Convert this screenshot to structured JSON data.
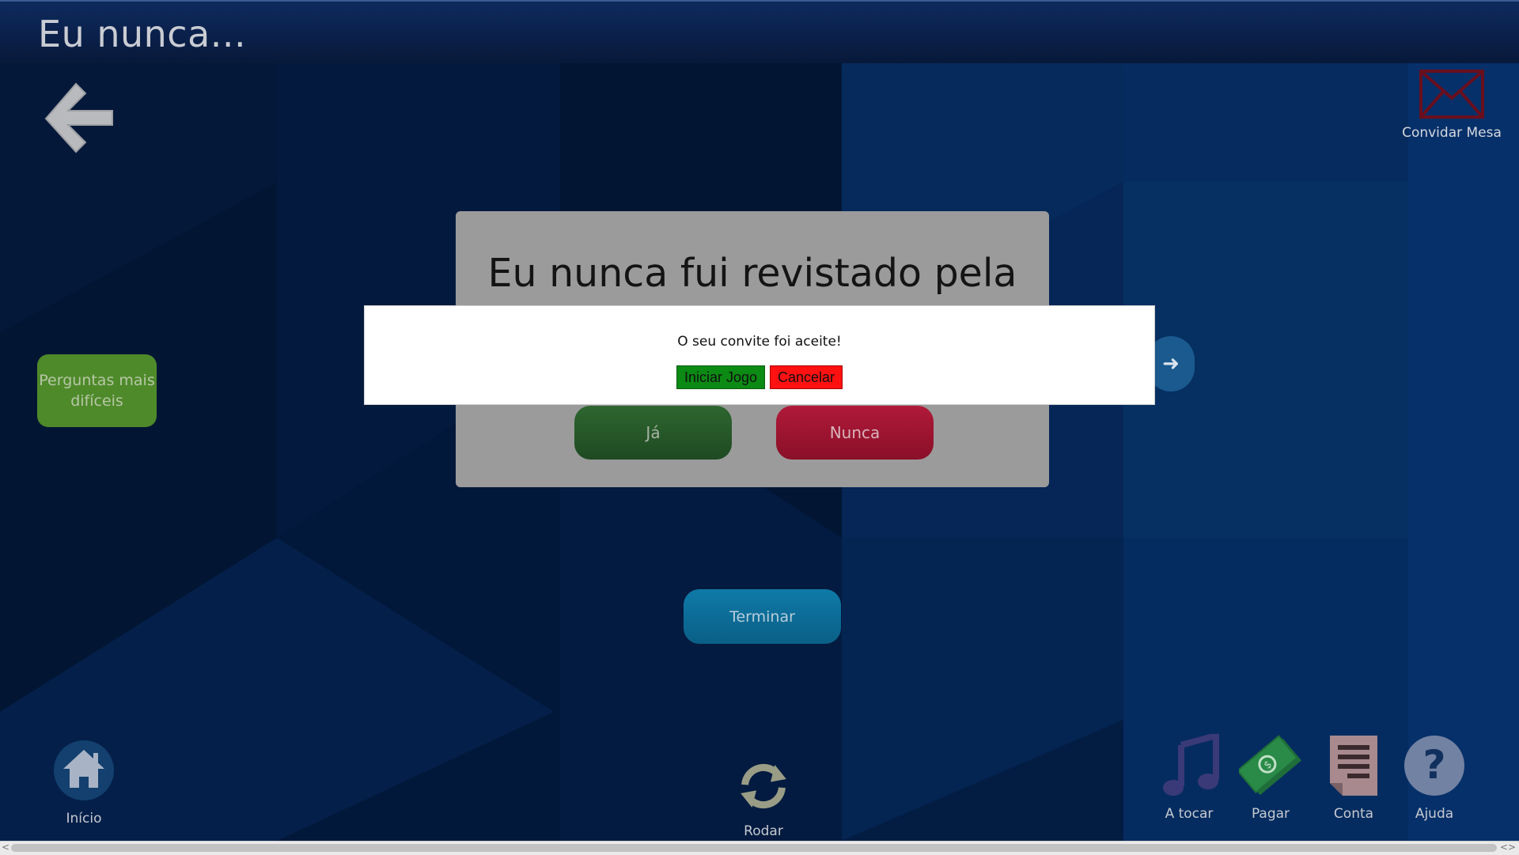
{
  "header": {
    "title": "Eu nunca..."
  },
  "invite": {
    "label": "Convidar Mesa",
    "icon": "envelope-icon"
  },
  "side": {
    "hard_questions": "Perguntas mais difíceis"
  },
  "card": {
    "question": "Eu nunca fui revistado pela",
    "yes_label": "Já",
    "never_label": "Nunca"
  },
  "dialog": {
    "message": "O seu convite foi aceite!",
    "start_label": "Iniciar Jogo",
    "cancel_label": "Cancelar"
  },
  "finish_label": "Terminar",
  "bottom_nav": {
    "home": "Início",
    "rotate": "Rodar",
    "playing": "A tocar",
    "pay": "Pagar",
    "bill": "Conta",
    "help": "Ajuda"
  },
  "colors": {
    "accent_green": "#4e8a2a",
    "yes_green": "#2e6630",
    "never_red": "#b01a3a",
    "finish_blue": "#0f7aa8",
    "start_button": "#0b8a14",
    "cancel_button": "#ff1111"
  }
}
